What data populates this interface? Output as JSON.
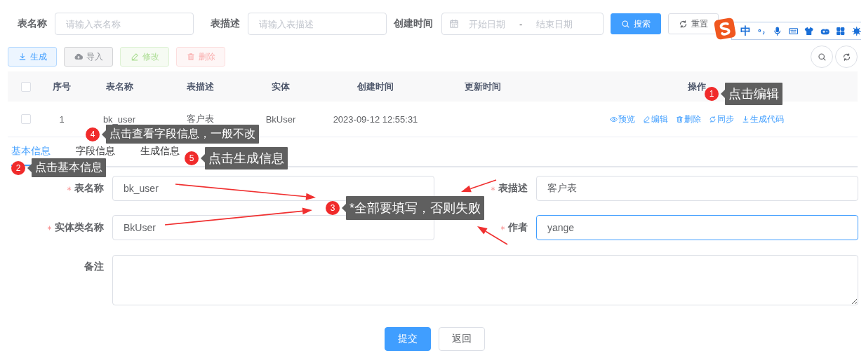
{
  "search_form": {
    "fields": [
      {
        "label": "表名称",
        "placeholder": "请输入表名称"
      },
      {
        "label": "表描述",
        "placeholder": "请输入表描述"
      }
    ],
    "date_range": {
      "label": "创建时间",
      "start_placeholder": "开始日期",
      "separator": "-",
      "end_placeholder": "结束日期"
    },
    "buttons": [
      {
        "label": "搜索",
        "kind": "primary"
      },
      {
        "label": "重置",
        "kind": "default"
      }
    ]
  },
  "ime_toolbar": {
    "mode": "中"
  },
  "toolbar": {
    "buttons": [
      {
        "label": "生成",
        "kind": "primary",
        "disabled": false
      },
      {
        "label": "导入",
        "kind": "info",
        "disabled": false
      },
      {
        "label": "修改",
        "kind": "success",
        "disabled": true
      },
      {
        "label": "删除",
        "kind": "danger",
        "disabled": true
      }
    ]
  },
  "table": {
    "select_all_checked": false,
    "columns": [
      "序号",
      "表名称",
      "表描述",
      "实体",
      "创建时间",
      "更新时间",
      "操作"
    ],
    "rows": [
      {
        "checked": false,
        "cells": [
          "1",
          "bk_user",
          "客户表",
          "BkUser",
          "2023-09-12 12:55:31"
        ],
        "actions": [
          "预览",
          "编辑",
          "删除",
          "同步",
          "生成代码"
        ]
      }
    ]
  },
  "tabs": [
    {
      "label": "基本信息",
      "selected": true
    },
    {
      "label": "字段信息",
      "selected": false
    },
    {
      "label": "生成信息",
      "selected": false
    }
  ],
  "form": {
    "fields": [
      {
        "label": "表名称",
        "required": true,
        "value": "bk_user",
        "focused": false
      },
      {
        "label": "表描述",
        "required": true,
        "value": "客户表",
        "focused": false
      },
      {
        "label": "实体类名称",
        "required": true,
        "value": "BkUser",
        "focused": false
      },
      {
        "label": "作者",
        "required": true,
        "value": "yange",
        "focused": true
      }
    ],
    "remark": {
      "label": "备注"
    },
    "buttons": [
      {
        "label": "提交",
        "kind": "primary"
      },
      {
        "label": "返回",
        "kind": "default"
      }
    ]
  },
  "annotations": [
    {
      "number": "1",
      "text": "点击编辑"
    },
    {
      "number": "4",
      "text": "点击查看字段信息，一般不改"
    },
    {
      "number": "5",
      "text": "点击生成信息"
    },
    {
      "number": "2",
      "text": "点击基本信息"
    },
    {
      "number": "3",
      "text": "*全部要填写，否则失败"
    }
  ]
}
